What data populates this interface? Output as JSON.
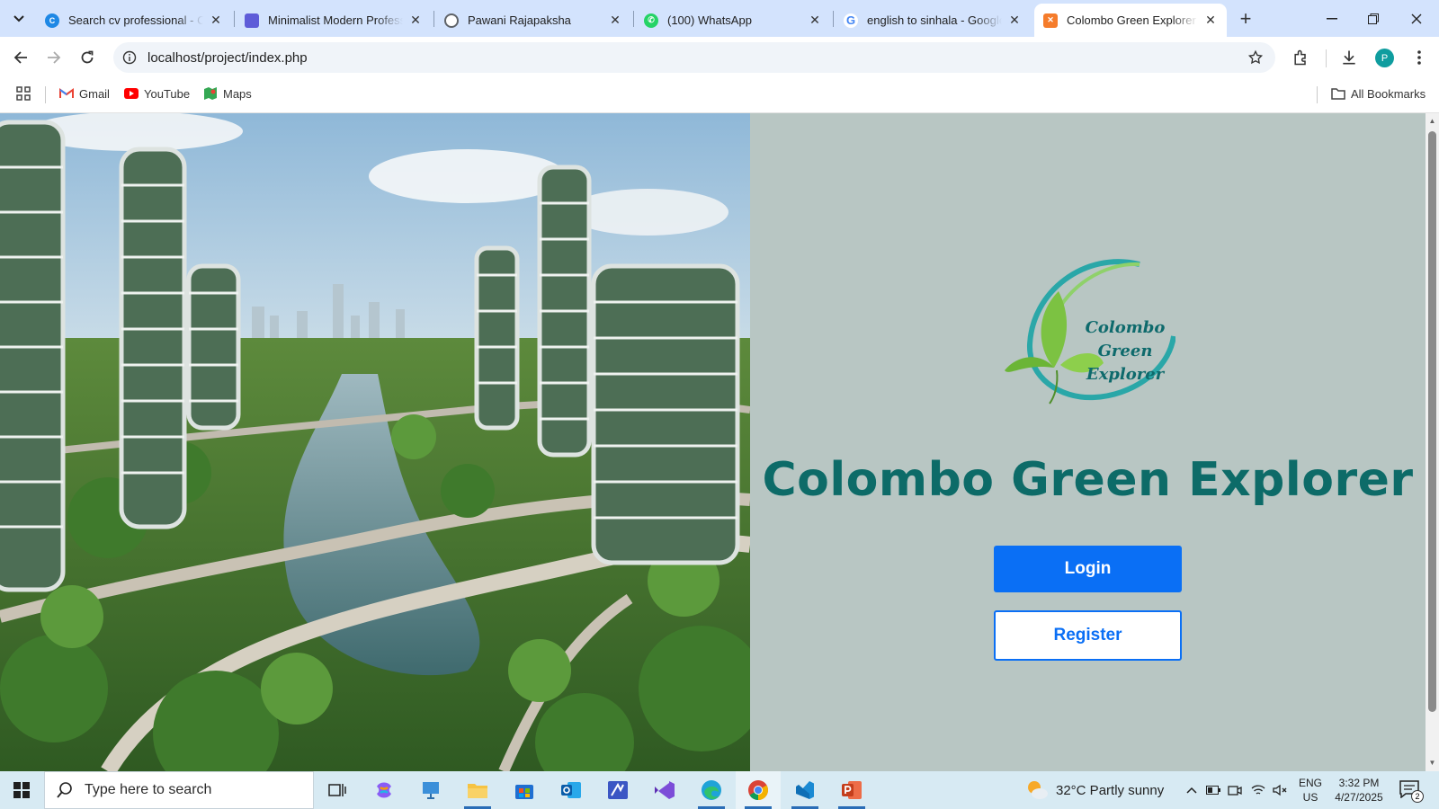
{
  "browser": {
    "tabs": [
      {
        "title": "Search cv professional - Ca",
        "favicon": "canva-icon",
        "color": "#1e88e5"
      },
      {
        "title": "Minimalist Modern Profess",
        "favicon": "document-icon",
        "color": "#5e5cd8"
      },
      {
        "title": "Pawani Rajapaksha",
        "favicon": "globe-icon",
        "color": "#5f6368"
      },
      {
        "title": "(100) WhatsApp",
        "favicon": "whatsapp-icon",
        "color": "#25d366"
      },
      {
        "title": "english to sinhala - Google",
        "favicon": "google-icon",
        "color": "#4285f4"
      },
      {
        "title": "Colombo Green Explorer",
        "favicon": "xampp-icon",
        "color": "#f57c2b",
        "active": true
      }
    ],
    "address_url": "localhost/project/index.php",
    "profile_initial": "P",
    "bookmarks": [
      {
        "label": "Gmail",
        "icon": "gmail-icon"
      },
      {
        "label": "YouTube",
        "icon": "youtube-icon"
      },
      {
        "label": "Maps",
        "icon": "maps-icon"
      }
    ],
    "all_bookmarks_label": "All Bookmarks"
  },
  "page": {
    "logo_text_line1": "Colombo",
    "logo_text_line2": "Green",
    "logo_text_line3": "Explorer",
    "title": "Colombo Green Explorer",
    "login_label": "Login",
    "register_label": "Register",
    "accent_color": "#0a6ff5",
    "title_color": "#0d6b68",
    "panel_color": "#b8c6c3"
  },
  "taskbar": {
    "search_placeholder": "Type here to search",
    "weather": "32°C  Partly sunny",
    "language_line1": "ENG",
    "language_line2": "US",
    "time": "3:32 PM",
    "date": "4/27/2025",
    "notification_count": "2"
  }
}
